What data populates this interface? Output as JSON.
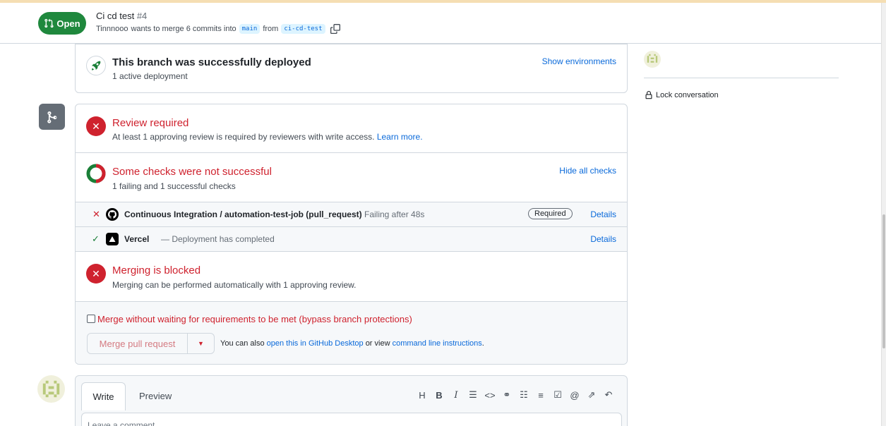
{
  "header": {
    "status": "Open",
    "title": "Ci cd test",
    "number": "#4",
    "author": "Tinnnooo",
    "merge_text": "wants to merge 6 commits into",
    "base_branch": "main",
    "from_text": "from",
    "head_branch": "ci-cd-test"
  },
  "deployment": {
    "title": "This branch was successfully deployed",
    "subtitle": "1 active deployment",
    "action": "Show environments"
  },
  "review": {
    "title": "Review required",
    "subtitle": "At least 1 approving review is required by reviewers with write access.",
    "link": "Learn more."
  },
  "checks": {
    "title": "Some checks were not successful",
    "subtitle": "1 failing and 1 successful checks",
    "action": "Hide all checks",
    "items": [
      {
        "name": "Continuous Integration / automation-test-job (pull_request)",
        "status": "Failing after 48s",
        "badge": "Required",
        "action": "Details"
      },
      {
        "name": "Vercel",
        "status": "— Deployment has completed",
        "action": "Details"
      }
    ]
  },
  "blocked": {
    "title": "Merging is blocked",
    "subtitle": "Merging can be performed automatically with 1 approving review."
  },
  "bypass": {
    "label": "Merge without waiting for requirements to be met (bypass branch protections)",
    "button": "Merge pull request",
    "also_text": "You can also",
    "desktop_link": "open this in GitHub Desktop",
    "or_text": "or view",
    "cli_link": "command line instructions",
    "period": "."
  },
  "comment": {
    "tab_write": "Write",
    "tab_preview": "Preview",
    "placeholder": "Leave a comment"
  },
  "sidebar": {
    "lock": "Lock conversation"
  },
  "colors": {
    "open_green": "#1f883d",
    "danger_red": "#cf222e",
    "link_blue": "#0969da"
  }
}
